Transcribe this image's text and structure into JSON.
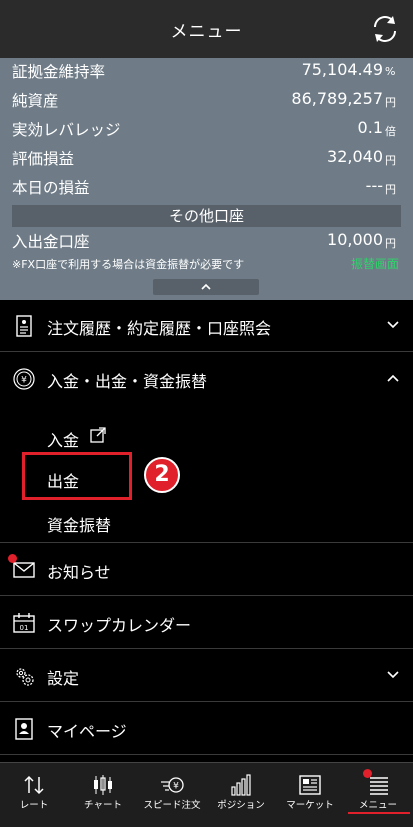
{
  "header": {
    "title": "メニュー",
    "refresh_icon": "refresh-icon"
  },
  "summary": {
    "rows": [
      {
        "label": "証拠金維持率",
        "value": "75,104.49",
        "unit": "%"
      },
      {
        "label": "純資産",
        "value": "86,789,257",
        "unit": "円"
      },
      {
        "label": "実効レバレッジ",
        "value": "0.1",
        "unit": "倍"
      },
      {
        "label": "評価損益",
        "value": "32,040",
        "unit": "円"
      },
      {
        "label": "本日の損益",
        "value": "---",
        "unit": "円"
      }
    ],
    "other_account_bar": "その他口座",
    "account": {
      "label": "入出金口座",
      "value": "10,000",
      "unit": "円"
    },
    "note": "※FX口座で利用する場合は資金振替が必要です",
    "transfer_link": "振替画面"
  },
  "menu": {
    "history": "注文履歴・約定履歴・口座照会",
    "funds": "入金・出金・資金振替",
    "deposit": "入金",
    "withdraw": "出金",
    "transfer": "資金振替",
    "notice": "お知らせ",
    "swap": "スワップカレンダー",
    "settings": "設定",
    "mypage": "マイページ",
    "step_badge": "2"
  },
  "tabs": [
    {
      "label": "レート"
    },
    {
      "label": "チャート"
    },
    {
      "label": "スピード注文"
    },
    {
      "label": "ポジション"
    },
    {
      "label": "マーケット"
    },
    {
      "label": "メニュー"
    }
  ],
  "colors": {
    "summary_bg": "#6f7c87",
    "accent_red": "#e0202a",
    "link_green": "#2fd36b"
  }
}
